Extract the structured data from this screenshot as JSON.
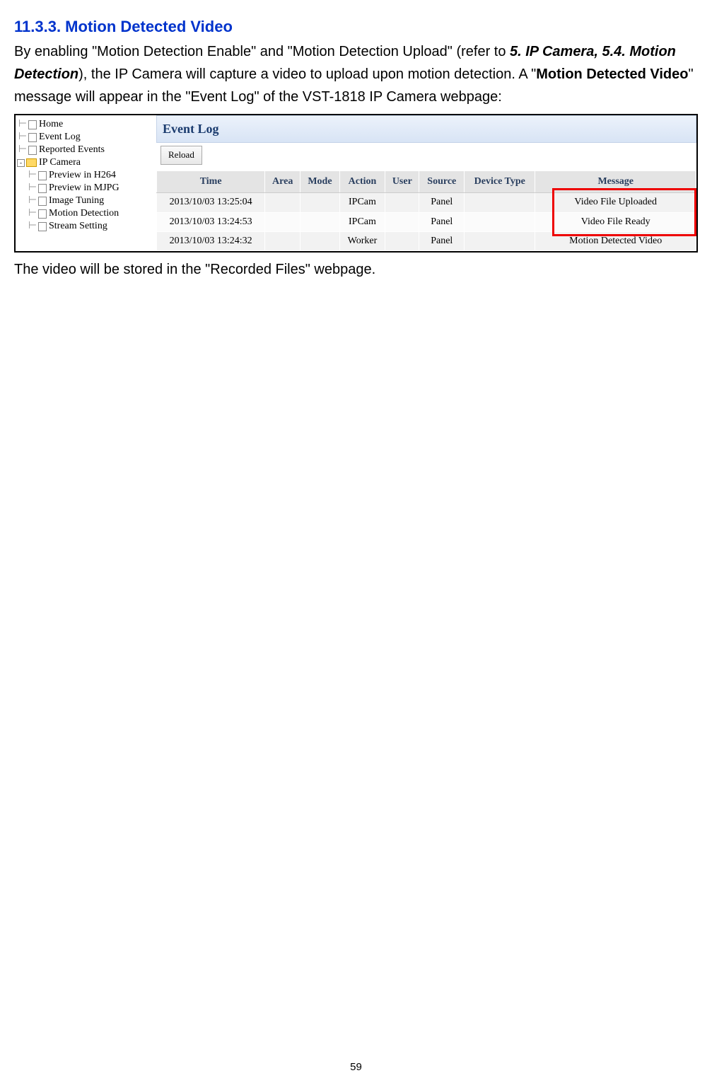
{
  "heading": "11.3.3. Motion Detected Video",
  "para1_prefix": "By enabling \"Motion Detection Enable\" and \"Motion Detection Upload\" (refer to ",
  "para1_emph1": "5. IP Camera, 5.4. Motion Detection",
  "para1_mid": "), the IP Camera will capture a video to upload upon motion detection. A \"",
  "para1_bold": "Motion Detected Video",
  "para1_suffix": "\" message will appear in the \"Event Log\" of the VST-1818 IP Camera webpage:",
  "para2": "The video will be stored in the \"Recorded Files\" webpage.",
  "page_number": "59",
  "tree": {
    "home": "Home",
    "event_log": "Event Log",
    "reported_events": "Reported Events",
    "ip_camera": "IP Camera",
    "preview_h264": "Preview in H264",
    "preview_mjpg": "Preview in MJPG",
    "image_tuning": "Image Tuning",
    "motion_detection": "Motion Detection",
    "stream_setting": "Stream Setting"
  },
  "panel_title": "Event Log",
  "reload_label": "Reload",
  "table": {
    "headers": [
      "Time",
      "Area",
      "Mode",
      "Action",
      "User",
      "Source",
      "Device Type",
      "Message"
    ],
    "rows": [
      {
        "time": "2013/10/03 13:25:04",
        "area": "",
        "mode": "",
        "action": "IPCam",
        "user": "",
        "source": "Panel",
        "device": "",
        "message": "Video File Uploaded"
      },
      {
        "time": "2013/10/03 13:24:53",
        "area": "",
        "mode": "",
        "action": "IPCam",
        "user": "",
        "source": "Panel",
        "device": "",
        "message": "Video File Ready"
      },
      {
        "time": "2013/10/03 13:24:32",
        "area": "",
        "mode": "",
        "action": "Worker",
        "user": "",
        "source": "Panel",
        "device": "",
        "message": "Motion Detected Video"
      }
    ]
  }
}
